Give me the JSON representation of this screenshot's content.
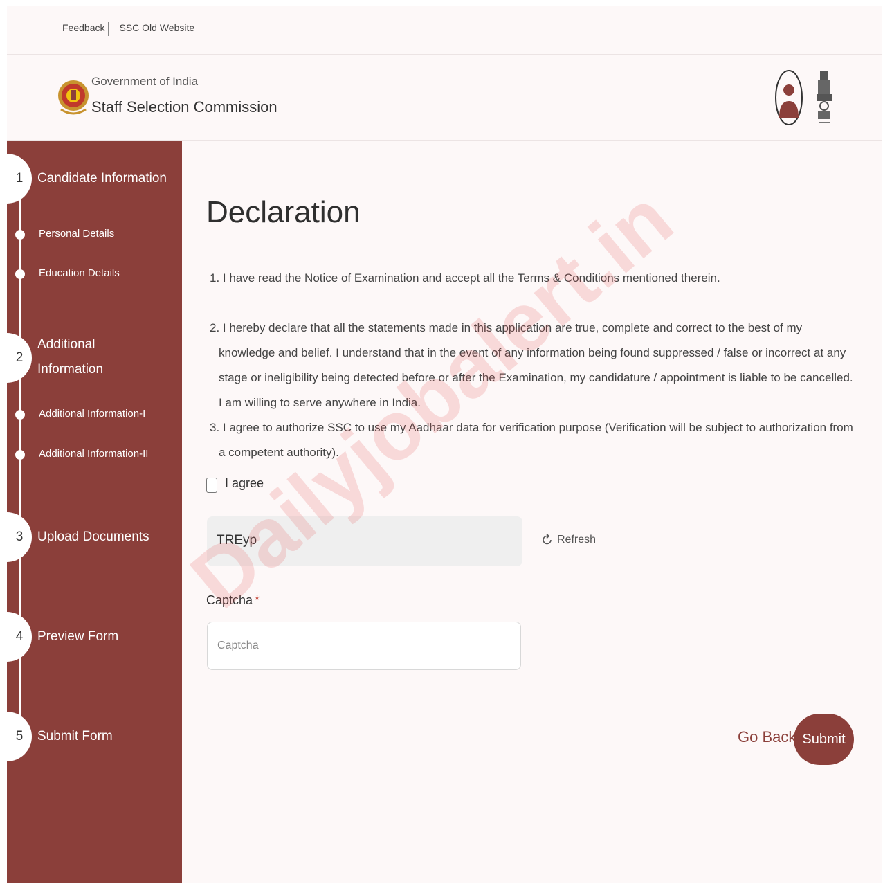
{
  "top_links": [
    "Feedback",
    "SSC Old Website"
  ],
  "header": {
    "gov_text": "Government of India",
    "org_name": "Staff Selection Commission",
    "logo_icon": "ssc-logo-icon",
    "user_icon": "user-avatar-icon",
    "emblem_icon": "national-emblem-icon"
  },
  "colors": {
    "primary": "#8b3f3a",
    "background": "#fdf8f8",
    "required": "#c0392b"
  },
  "sidebar": {
    "steps": [
      {
        "number": "1",
        "label": "Candidate Information",
        "subs": [
          "Personal Details",
          "Education Details"
        ]
      },
      {
        "number": "2",
        "label_lines": [
          "Additional",
          "Information"
        ],
        "subs": [
          "Additional Information-I",
          "Additional Information-II"
        ]
      },
      {
        "number": "3",
        "label": "Upload Documents"
      },
      {
        "number": "4",
        "label": "Preview Form"
      },
      {
        "number": "5",
        "label": "Submit Form"
      }
    ]
  },
  "main": {
    "title": "Declaration",
    "declarations": [
      "1. I have read the Notice of Examination and accept all the Terms & Conditions mentioned therein.",
      "2. I hereby declare that all the statements made in this application are true, complete and correct to the best of my knowledge and belief. I understand that in the event of any information being found suppressed / false or incorrect at any stage or ineligibility being detected before or after the Examination, my candidature / appointment is liable to be cancelled. I am willing to serve anywhere in India.",
      "3. I agree to authorize SSC to use my Aadhaar data for verification purpose (Verification will be subject to authorization from a competent authority)."
    ],
    "agree_label": "I agree",
    "agree_checked": false,
    "captcha_text": "TREyp",
    "refresh_label": "Refresh",
    "captcha_label": "Captcha",
    "captcha_required": "*",
    "captcha_placeholder": "Captcha",
    "captcha_value": "",
    "go_back_label": "Go Back",
    "submit_label": "Submit"
  },
  "watermark": "Dailyjobalert.in"
}
